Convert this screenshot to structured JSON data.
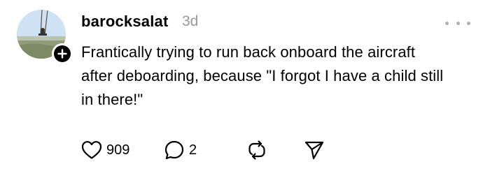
{
  "post": {
    "username": "barocksalat",
    "timestamp": "3d",
    "text": "Frantically trying to run back onboard the aircraft after deboarding, because \"I forgot I have a child still in there!\"",
    "likes": "909",
    "replies": "2"
  },
  "icons": {
    "avatar": "avatar-photo",
    "follow": "plus-icon",
    "more": "more-dots-icon",
    "like": "heart-icon",
    "reply": "comment-bubble-icon",
    "repost": "repost-icon",
    "share": "send-icon"
  },
  "colors": {
    "text": "#000000",
    "muted": "#999999",
    "badge": "#000000"
  }
}
